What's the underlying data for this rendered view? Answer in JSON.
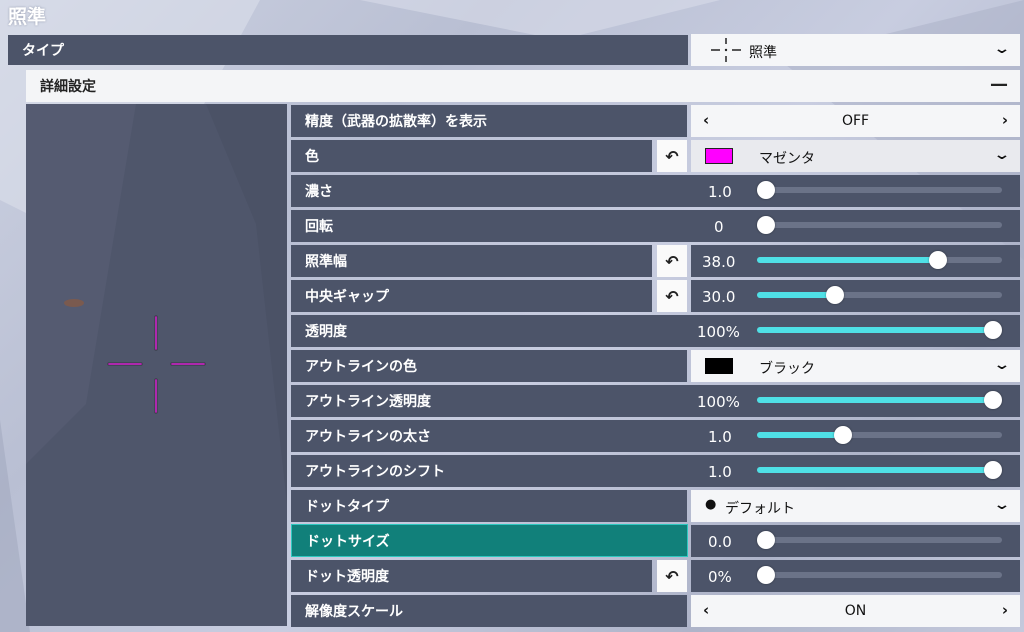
{
  "page": {
    "title": "照準"
  },
  "type_row": {
    "label": "タイプ",
    "value": "照準"
  },
  "advanced": {
    "label": "詳細設定",
    "collapse_icon": "minus-icon"
  },
  "colors": {
    "accent": "#4fe0e6",
    "panel": "#4c5469",
    "highlight": "#11807a",
    "crosshair": "#e02de0"
  },
  "settings": {
    "accuracy": {
      "label": "精度（武器の拡散率）を表示",
      "value": "OFF"
    },
    "color": {
      "label": "色",
      "value": "マゼンタ",
      "swatch": "#ff00ff"
    },
    "density": {
      "label": "濃さ",
      "value": "1.0",
      "fill": 0.0
    },
    "rotation": {
      "label": "回転",
      "value": "0",
      "fill": 0.0
    },
    "crosshair_width": {
      "label": "照準幅",
      "value": "38.0",
      "fill": 0.74
    },
    "center_gap": {
      "label": "中央ギャップ",
      "value": "30.0",
      "fill": 0.32
    },
    "opacity": {
      "label": "透明度",
      "value": "100%",
      "fill": 1.0
    },
    "outline_color": {
      "label": "アウトラインの色",
      "value": "ブラック",
      "swatch": "#000000"
    },
    "outline_opacity": {
      "label": "アウトライン透明度",
      "value": "100%",
      "fill": 1.0
    },
    "outline_thickness": {
      "label": "アウトラインの太さ",
      "value": "1.0",
      "fill": 0.35
    },
    "outline_shift": {
      "label": "アウトラインのシフト",
      "value": "1.0",
      "fill": 1.0
    },
    "dot_type": {
      "label": "ドットタイプ",
      "value": "デフォルト"
    },
    "dot_size": {
      "label": "ドットサイズ",
      "value": "0.0",
      "fill": 0.0
    },
    "dot_opacity": {
      "label": "ドット透明度",
      "value": "0%",
      "fill": 0.0
    },
    "resolution_scale": {
      "label": "解像度スケール",
      "value": "ON"
    }
  }
}
